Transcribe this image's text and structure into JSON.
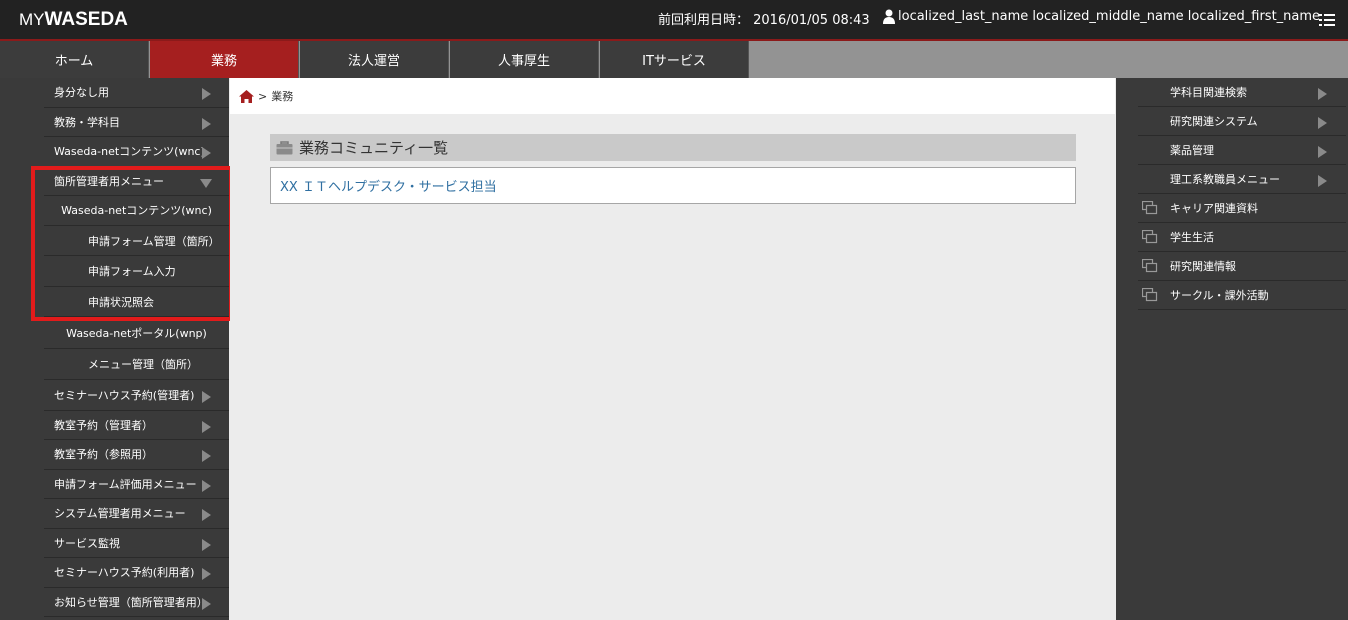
{
  "app": {
    "logo_my": "MY",
    "logo_waseda": "WASEDA"
  },
  "header": {
    "last_use": "前回利用日時： 2016/01/05 08:43",
    "user_name": "localized_last_name localized_middle_name localized_first_name"
  },
  "tabs": [
    {
      "label": "ホーム"
    },
    {
      "label": "業務"
    },
    {
      "label": "法人運営"
    },
    {
      "label": "人事厚生"
    },
    {
      "label": "ITサービス"
    }
  ],
  "sidebar": {
    "items": [
      {
        "label": "身分なし用"
      },
      {
        "label": "教務・学科目"
      },
      {
        "label": "Waseda-netコンテンツ(wnc)"
      },
      {
        "label": "箇所管理者用メニュー"
      },
      {
        "label": "Waseda-netコンテンツ(wnc)"
      },
      {
        "label": "申請フォーム管理（箇所）"
      },
      {
        "label": "申請フォーム入力"
      },
      {
        "label": "申請状況照会"
      },
      {
        "label": "Waseda-netポータル(wnp)"
      },
      {
        "label": "メニュー管理（箇所）"
      },
      {
        "label": "セミナーハウス予約(管理者)"
      },
      {
        "label": "教室予約（管理者）"
      },
      {
        "label": "教室予約（参照用）"
      },
      {
        "label": "申請フォーム評価用メニュー"
      },
      {
        "label": "システム管理者用メニュー"
      },
      {
        "label": "サービス監視"
      },
      {
        "label": "セミナーハウス予約(利用者)"
      },
      {
        "label": "お知らせ管理（箇所管理者用）"
      }
    ]
  },
  "breadcrumb": {
    "separator": ">",
    "current": "業務"
  },
  "main": {
    "section_title": "業務コミュニティ一覧",
    "community_link": "XX ＩＴヘルプデスク・サービス担当"
  },
  "right_sidebar": {
    "items": [
      {
        "label": "学科目関連検索"
      },
      {
        "label": "研究関連システム"
      },
      {
        "label": "薬品管理"
      },
      {
        "label": "理工系教職員メニュー"
      },
      {
        "label": "キャリア関連資料"
      },
      {
        "label": "学生生活"
      },
      {
        "label": "研究関連情報"
      },
      {
        "label": "サークル・課外活動"
      }
    ]
  },
  "colors": {
    "accent": "#a51f1f",
    "highlight": "#e21b1b",
    "link": "#2f6fa1"
  }
}
